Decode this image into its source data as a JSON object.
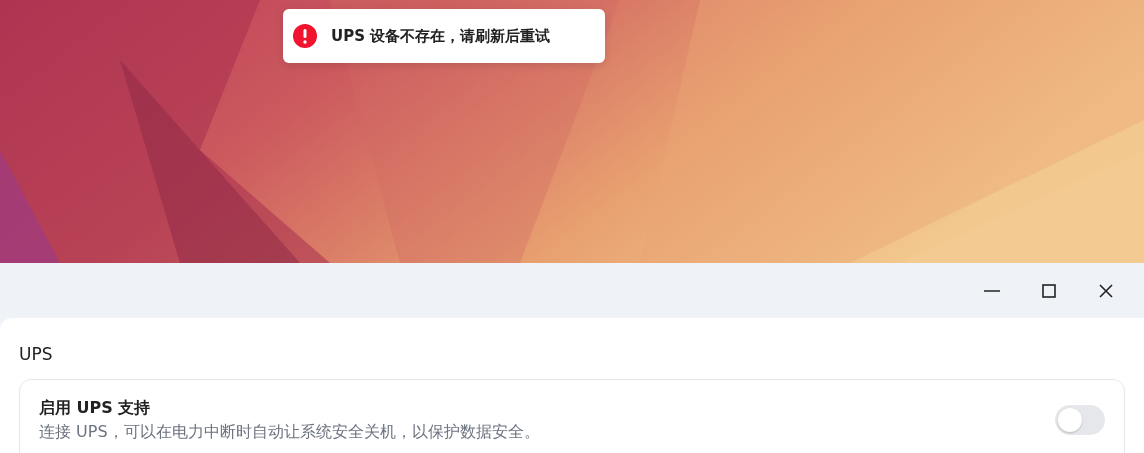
{
  "toast": {
    "kind": "error",
    "message": "UPS 设备不存在，请刷新后重试"
  },
  "window": {
    "section_title": "UPS",
    "settings": [
      {
        "title": "启用 UPS 支持",
        "description": "连接 UPS，可以在电力中断时自动让系统安全关机，以保护数据安全。",
        "on": false
      }
    ]
  }
}
